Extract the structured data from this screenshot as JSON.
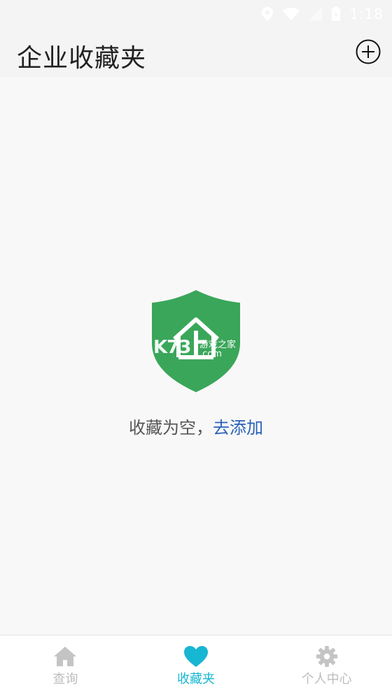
{
  "status_bar": {
    "time": "1:18",
    "icons": [
      "location-icon",
      "wifi-icon",
      "signal-icon",
      "battery-icon"
    ]
  },
  "header": {
    "title": "企业收藏夹",
    "add_icon": "plus-circle-icon"
  },
  "empty_state": {
    "message": "收藏为空，",
    "action_link": "去添加",
    "logo_icon": "green-shield-house-icon",
    "watermark_k73": "K73",
    "watermark_cn": "游戏之家",
    "watermark_domain": ".com"
  },
  "bottom_nav": {
    "items": [
      {
        "label": "查询",
        "icon": "home-icon",
        "active": false
      },
      {
        "label": "收藏夹",
        "icon": "heart-icon",
        "active": true
      },
      {
        "label": "个人中心",
        "icon": "gear-icon",
        "active": false
      }
    ]
  },
  "colors": {
    "accent": "#17b6d2",
    "link": "#2a62b8",
    "shield": "#3aa65a",
    "inactive": "#bdbdbd"
  }
}
